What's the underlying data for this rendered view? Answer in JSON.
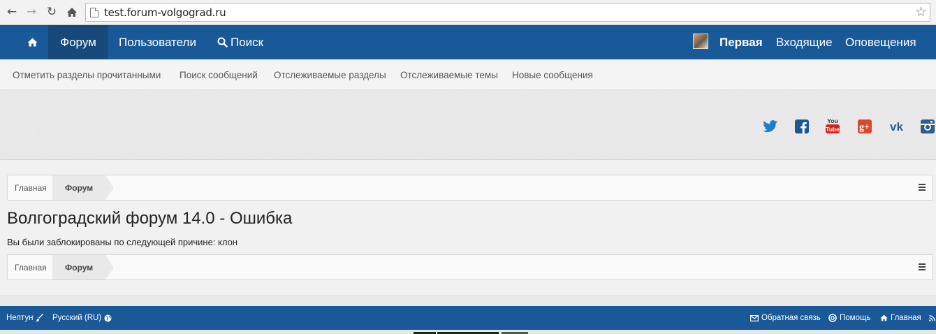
{
  "browser": {
    "url": "test.forum-volgograd.ru",
    "back_icon": "arrow-left-icon",
    "forward_icon": "arrow-right-icon",
    "reload_icon": "reload-icon",
    "home_icon": "home-icon",
    "bookmark_icon": "star-icon"
  },
  "topnav": {
    "home_icon": "home-icon",
    "forum": "Форум",
    "users": "Пользователи",
    "search": "Поиск",
    "user": "Первая",
    "inbox": "Входящие",
    "alerts": "Оповещения",
    "bg_color": "#1a5998",
    "active_color": "#17497c"
  },
  "subnav": {
    "links": [
      "Отметить разделы прочитанными",
      "Поиск сообщений",
      "Отслеживаемые разделы",
      "Отслеживаемые темы",
      "Новые сообщения"
    ]
  },
  "social": [
    "twitter-icon",
    "facebook-icon",
    "youtube-icon",
    "google-plus-icon",
    "vk-icon",
    "instagram-icon"
  ],
  "breadcrumb": {
    "home": "Главная",
    "current": "Форум"
  },
  "page": {
    "title": "Волгоградский форум 14.0 - Ошибка",
    "message": "Вы были заблокированы по следующей причине: клон"
  },
  "footer": {
    "style": "Нептун",
    "language": "Русский (RU)",
    "feedback": "Обратная связь",
    "help": "Помощь",
    "home": "Главная",
    "rss_icon": "rss-icon"
  }
}
